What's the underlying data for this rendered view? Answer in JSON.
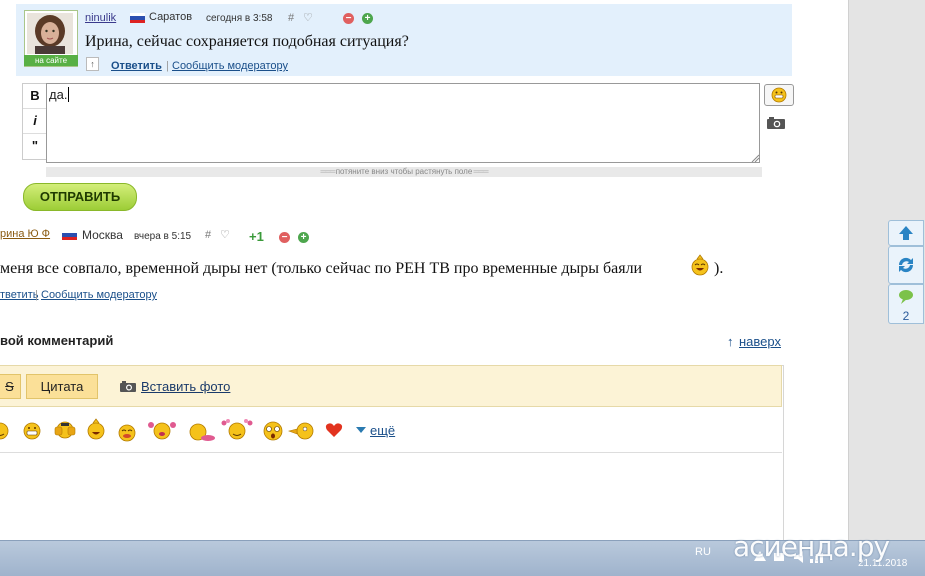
{
  "comment_reply_target": {
    "author": "ninulik",
    "city": "Саратов",
    "time": "сегодня в 3:58",
    "hash": "#",
    "heart": "♡",
    "status_badge": "на сайте",
    "text": "Ирина, сейчас сохраняется подобная ситуация?",
    "reply_label": "Ответить",
    "separator": "|",
    "report_label": "Сообщить модератору"
  },
  "reply_editor": {
    "format_buttons": [
      "B",
      "i",
      "\""
    ],
    "text_value": "да.",
    "stretch_hint": "потяните вниз чтобы растянуть поле",
    "send_label": "ОТПРАВИТЬ"
  },
  "comment_2": {
    "author": "рина Ю Ф",
    "city": "Москва",
    "time": "вчера в 5:15",
    "hash": "#",
    "heart": "♡",
    "score": "+1",
    "text_a": "меня все совпало, временной дыры нет (только сейчас по РЕН ТВ про временные дыры баяли",
    "text_b": ").",
    "reply_label": "тветить",
    "separator": "|",
    "report_label": "Сообщить модератору"
  },
  "new_comment": {
    "title": "вой комментарий",
    "to_top_arrow": "↑",
    "to_top_label": "наверх",
    "strike_label": "S",
    "quote_label": "Цитата",
    "insert_photo_label": "Вставить фото",
    "more_label": "ещё"
  },
  "side_widget": {
    "comment_count": "2"
  },
  "taskbar": {
    "language": "RU",
    "date": "21.11.2018",
    "watermark": "асиенда.ру"
  },
  "colors": {
    "highlight_bg": "#e3f0fc",
    "link": "#1a4f8a",
    "send_button": "#b3dc4e",
    "toolbar_bg": "#fcf3d6"
  }
}
